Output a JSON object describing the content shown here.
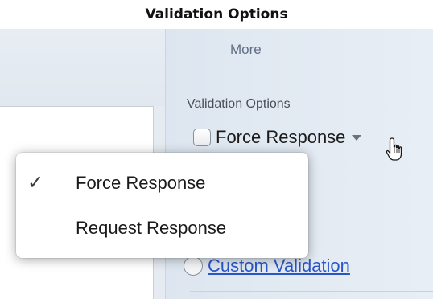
{
  "caption": "Validation Options",
  "panel": {
    "more_link": "More",
    "section_label": "Validation Options",
    "force_response_label": "Force Response",
    "custom_validation_label": "Custom Validation"
  },
  "dropdown": {
    "items": [
      {
        "label": "Force Response",
        "checked": true,
        "check_glyph": "✓"
      },
      {
        "label": "Request Response",
        "checked": false
      }
    ]
  },
  "icons": {
    "checkmark": "check-icon",
    "caret": "chevron-down-icon",
    "cursor": "hand-pointer-icon"
  }
}
